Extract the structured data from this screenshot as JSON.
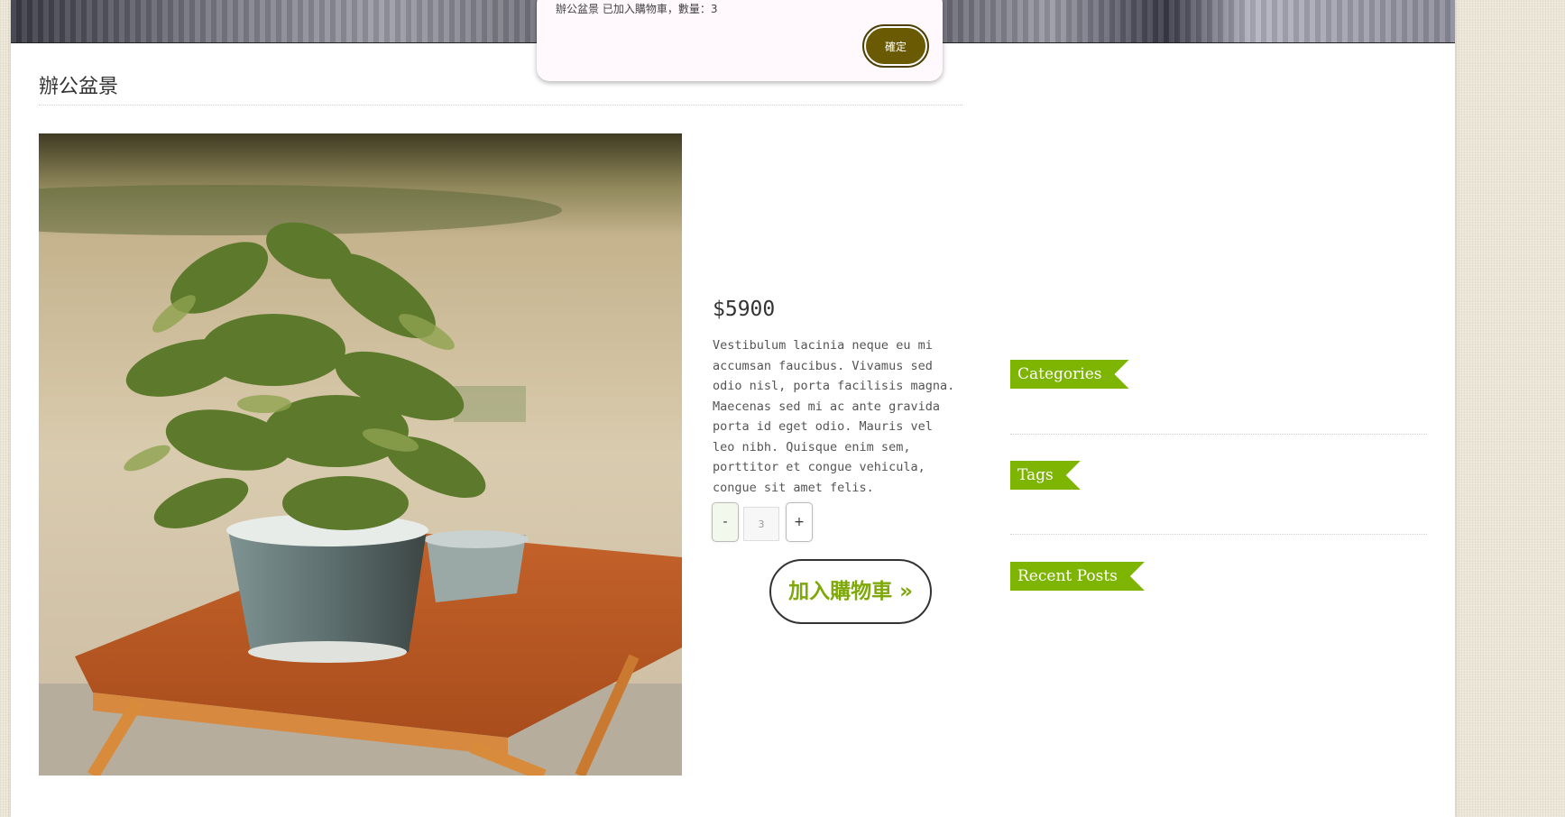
{
  "product": {
    "title": "辦公盆景",
    "price": "$5900",
    "description": "Vestibulum lacinia neque eu mi accumsan faucibus. Vivamus sed odio nisl, porta facilisis magna. Maecenas sed mi ac ante gravida porta id eget odio. Mauris vel leo nibh. Quisque enim sem, porttitor et congue vehicula, congue sit amet felis.",
    "quantity": "3",
    "minus_label": "-",
    "plus_label": "+",
    "add_to_cart_label": "加入購物車 »"
  },
  "sidebar": {
    "widgets": [
      {
        "title": "Categories"
      },
      {
        "title": "Tags"
      },
      {
        "title": "Recent Posts"
      }
    ]
  },
  "dialog": {
    "message": "辦公盆景 已加入購物車，數量：3",
    "confirm_label": "確定"
  },
  "colors": {
    "accent_green": "#7db502",
    "button_olive": "#6b5a04",
    "cart_text_green": "#7fa80a"
  }
}
